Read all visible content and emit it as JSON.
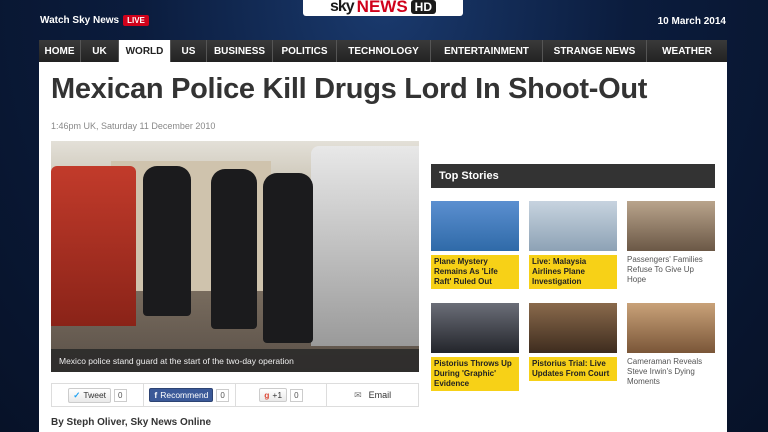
{
  "header": {
    "watch_label": "Watch Sky News",
    "live_badge": "LIVE",
    "logo_sky": "sky",
    "logo_news": "NEWS",
    "logo_hd": "HD",
    "date": "10 March 2014"
  },
  "nav": {
    "items": [
      "HOME",
      "UK",
      "WORLD",
      "US",
      "BUSINESS",
      "POLITICS",
      "TECHNOLOGY",
      "ENTERTAINMENT",
      "STRANGE NEWS",
      "WEATHER"
    ],
    "active": "WORLD"
  },
  "article": {
    "headline": "Mexican Police Kill Drugs Lord In Shoot-Out",
    "timestamp": "1:46pm UK, Saturday 11 December 2010",
    "caption": "Mexico police stand guard at the start of the two-day operation",
    "byline": "By Steph Oliver, Sky News Online"
  },
  "share": {
    "tweet_label": "Tweet",
    "tweet_count": "0",
    "recommend_label": "Recommend",
    "recommend_count": "0",
    "gplus_label": "+1",
    "gplus_count": "0",
    "email_label": "Email"
  },
  "top_stories": {
    "title": "Top Stories",
    "items": [
      {
        "label": "Plane Mystery Remains As 'Life Raft' Ruled Out",
        "highlight": true
      },
      {
        "label": "Live: Malaysia Airlines Plane Investigation",
        "highlight": true
      },
      {
        "label": "Passengers' Families Refuse To Give Up Hope",
        "highlight": false
      },
      {
        "label": "Pistorius Throws Up During 'Graphic' Evidence",
        "highlight": true
      },
      {
        "label": "Pistorius Trial: Live Updates From Court",
        "highlight": true
      },
      {
        "label": "Cameraman Reveals Steve Irwin's Dying Moments",
        "highlight": false
      }
    ]
  },
  "colors": {
    "accent_yellow": "#f7d117",
    "live_red": "#d0021b",
    "nav_dark": "#2c2c2c"
  }
}
